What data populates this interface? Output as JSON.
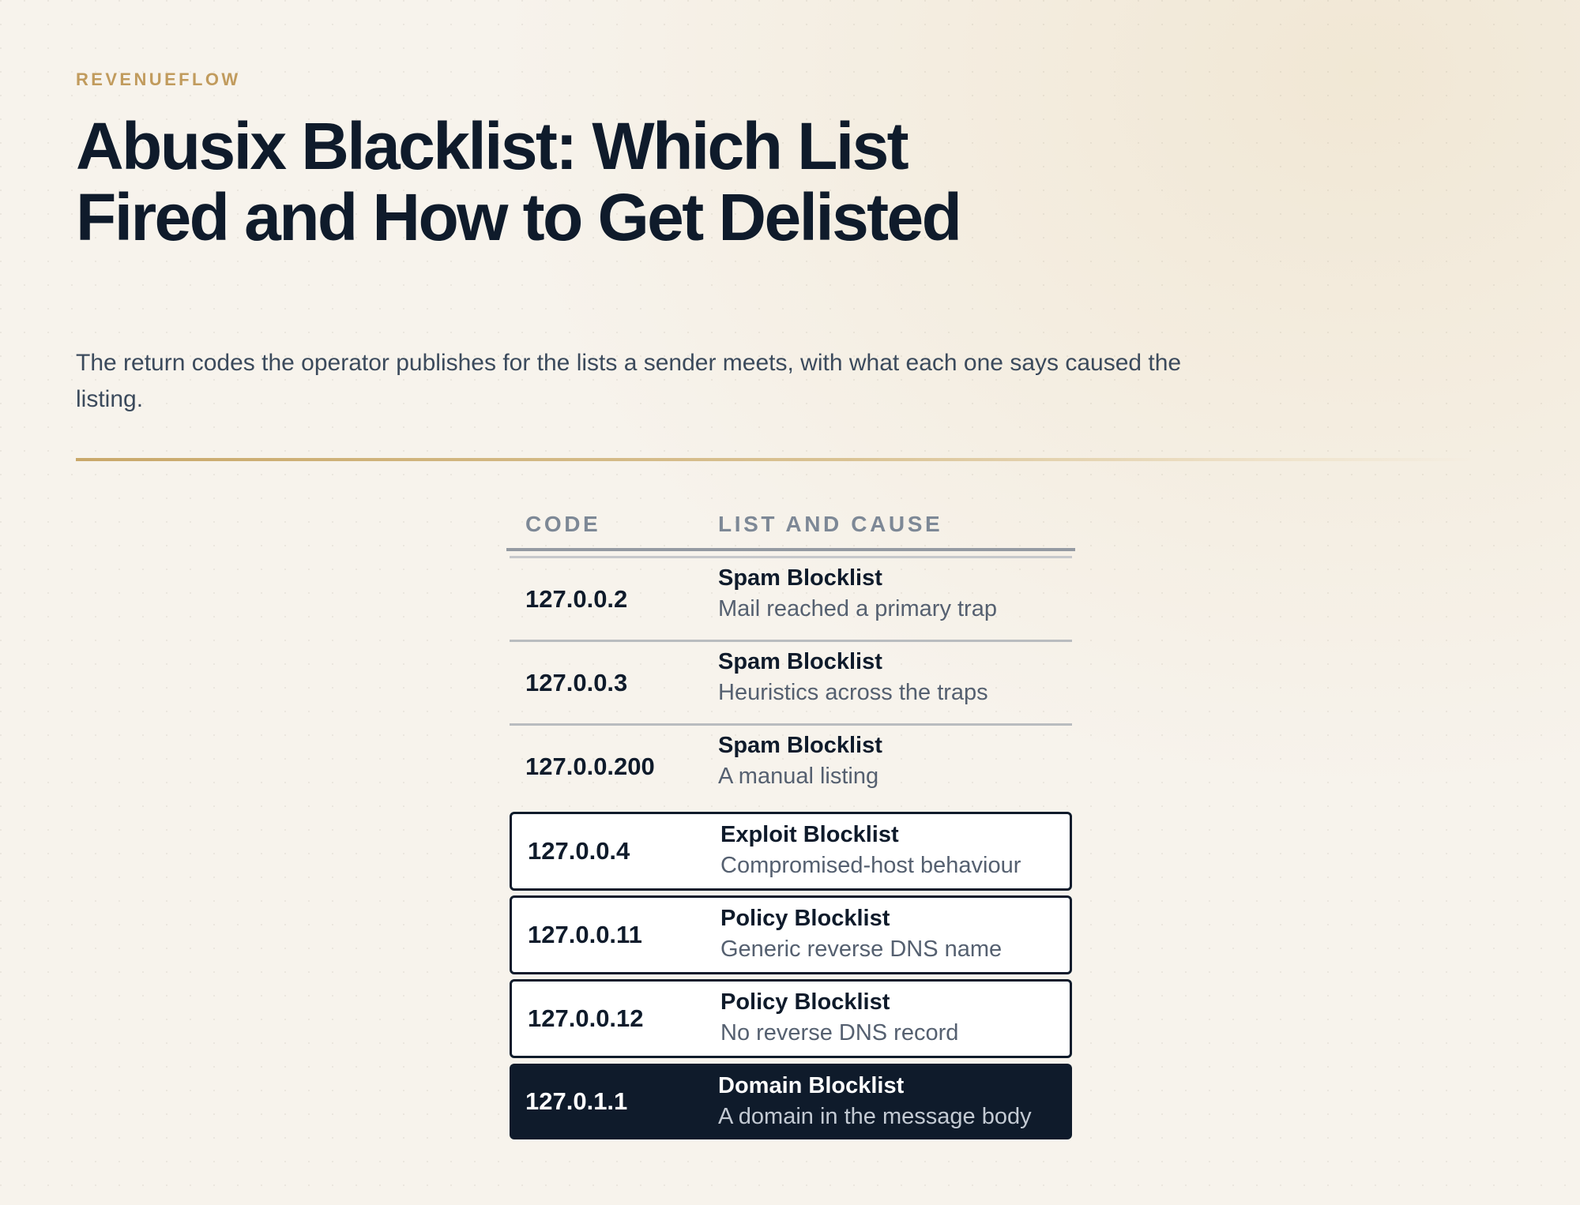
{
  "brand": "REVENUEFLOW",
  "title": "Abusix Blacklist: Which List Fired and How to Get Delisted",
  "subtitle": "The return codes the operator publishes for the lists a sender meets, with what each one says caused the listing.",
  "table": {
    "headers": {
      "code": "CODE",
      "list": "LIST AND CAUSE"
    },
    "rows": [
      {
        "code": "127.0.0.2",
        "list": "Spam Blocklist",
        "cause": "Mail reached a primary trap",
        "style": "plain"
      },
      {
        "code": "127.0.0.3",
        "list": "Spam Blocklist",
        "cause": "Heuristics across the traps",
        "style": "plain"
      },
      {
        "code": "127.0.0.200",
        "list": "Spam Blocklist",
        "cause": "A manual listing",
        "style": "plain"
      },
      {
        "code": "127.0.0.4",
        "list": "Exploit Blocklist",
        "cause": "Compromised-host behaviour",
        "style": "outlined"
      },
      {
        "code": "127.0.0.11",
        "list": "Policy Blocklist",
        "cause": "Generic reverse DNS name",
        "style": "outlined"
      },
      {
        "code": "127.0.0.12",
        "list": "Policy Blocklist",
        "cause": "No reverse DNS record",
        "style": "outlined"
      },
      {
        "code": "127.0.1.1",
        "list": "Domain Blocklist",
        "cause": "A domain in the message body",
        "style": "highlighted"
      }
    ]
  },
  "colors": {
    "accent": "#c19b5d",
    "ink": "#0f1b2b",
    "background": "#f7f3ec"
  }
}
